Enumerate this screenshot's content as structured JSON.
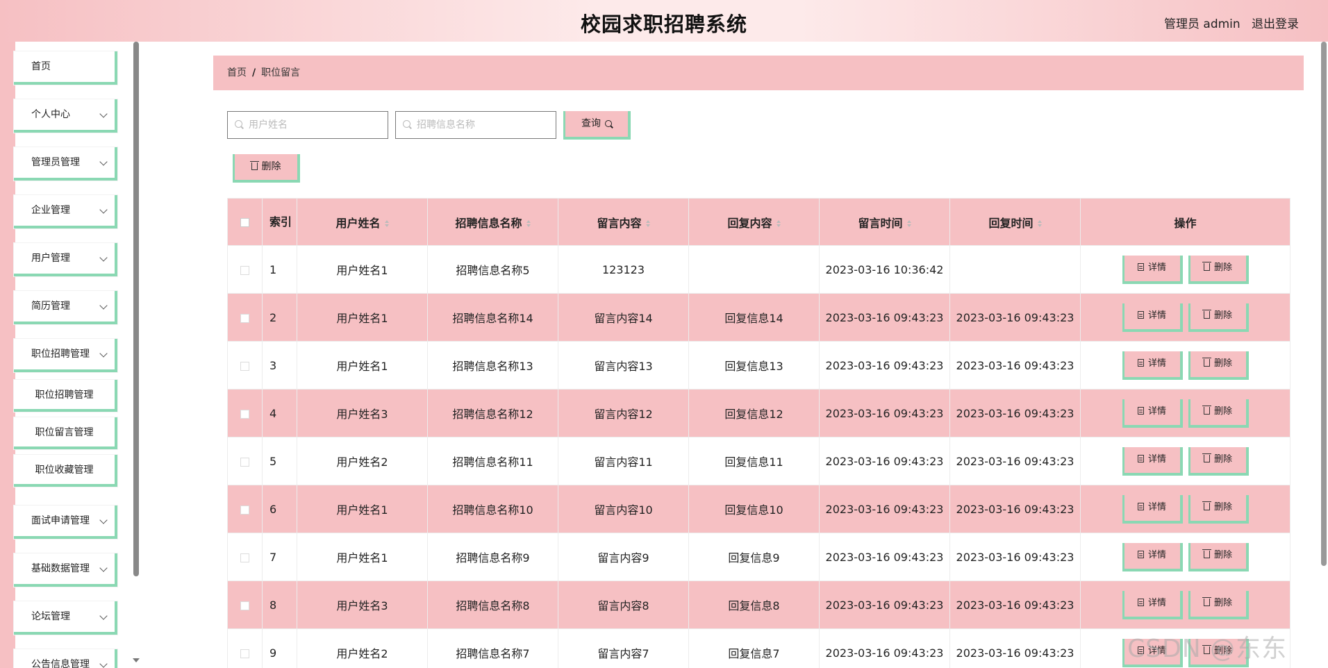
{
  "header": {
    "title": "校园求职招聘系统",
    "admin_label": "管理员 admin",
    "logout_label": "退出登录"
  },
  "sidebar": {
    "items": [
      {
        "label": "首页"
      },
      {
        "label": "个人中心"
      },
      {
        "label": "管理员管理"
      },
      {
        "label": "企业管理"
      },
      {
        "label": "用户管理"
      },
      {
        "label": "简历管理"
      },
      {
        "label": "职位招聘管理"
      },
      {
        "label": "面试申请管理"
      },
      {
        "label": "基础数据管理"
      },
      {
        "label": "论坛管理"
      },
      {
        "label": "公告信息管理"
      }
    ],
    "subitems": [
      {
        "label": "职位招聘管理"
      },
      {
        "label": "职位留言管理"
      },
      {
        "label": "职位收藏管理"
      }
    ]
  },
  "breadcrumb": {
    "home": "首页",
    "separator": "/",
    "current": "职位留言"
  },
  "search": {
    "username_placeholder": "用户姓名",
    "jobname_placeholder": "招聘信息名称",
    "search_label": "查询",
    "delete_label": "删除"
  },
  "table": {
    "headers": {
      "index": "索引",
      "username": "用户姓名",
      "jobname": "招聘信息名称",
      "message": "留言内容",
      "reply": "回复内容",
      "msg_time": "留言时间",
      "reply_time": "回复时间",
      "actions": "操作"
    },
    "detail_label": "详情",
    "delete_label": "删除",
    "rows": [
      {
        "index": "1",
        "username": "用户姓名1",
        "jobname": "招聘信息名称5",
        "message": "123123",
        "reply": "",
        "msg_time": "2023-03-16 10:36:42",
        "reply_time": ""
      },
      {
        "index": "2",
        "username": "用户姓名1",
        "jobname": "招聘信息名称14",
        "message": "留言内容14",
        "reply": "回复信息14",
        "msg_time": "2023-03-16 09:43:23",
        "reply_time": "2023-03-16 09:43:23"
      },
      {
        "index": "3",
        "username": "用户姓名1",
        "jobname": "招聘信息名称13",
        "message": "留言内容13",
        "reply": "回复信息13",
        "msg_time": "2023-03-16 09:43:23",
        "reply_time": "2023-03-16 09:43:23"
      },
      {
        "index": "4",
        "username": "用户姓名3",
        "jobname": "招聘信息名称12",
        "message": "留言内容12",
        "reply": "回复信息12",
        "msg_time": "2023-03-16 09:43:23",
        "reply_time": "2023-03-16 09:43:23"
      },
      {
        "index": "5",
        "username": "用户姓名2",
        "jobname": "招聘信息名称11",
        "message": "留言内容11",
        "reply": "回复信息11",
        "msg_time": "2023-03-16 09:43:23",
        "reply_time": "2023-03-16 09:43:23"
      },
      {
        "index": "6",
        "username": "用户姓名1",
        "jobname": "招聘信息名称10",
        "message": "留言内容10",
        "reply": "回复信息10",
        "msg_time": "2023-03-16 09:43:23",
        "reply_time": "2023-03-16 09:43:23"
      },
      {
        "index": "7",
        "username": "用户姓名1",
        "jobname": "招聘信息名称9",
        "message": "留言内容9",
        "reply": "回复信息9",
        "msg_time": "2023-03-16 09:43:23",
        "reply_time": "2023-03-16 09:43:23"
      },
      {
        "index": "8",
        "username": "用户姓名3",
        "jobname": "招聘信息名称8",
        "message": "留言内容8",
        "reply": "回复信息8",
        "msg_time": "2023-03-16 09:43:23",
        "reply_time": "2023-03-16 09:43:23"
      },
      {
        "index": "9",
        "username": "用户姓名2",
        "jobname": "招聘信息名称7",
        "message": "留言内容7",
        "reply": "回复信息7",
        "msg_time": "2023-03-16 09:43:23",
        "reply_time": "2023-03-16 09:43:23"
      }
    ]
  },
  "watermark": "CSDN @东东516",
  "colors": {
    "accent_pink": "#f6c0c3",
    "accent_green": "#8ad8b3"
  }
}
